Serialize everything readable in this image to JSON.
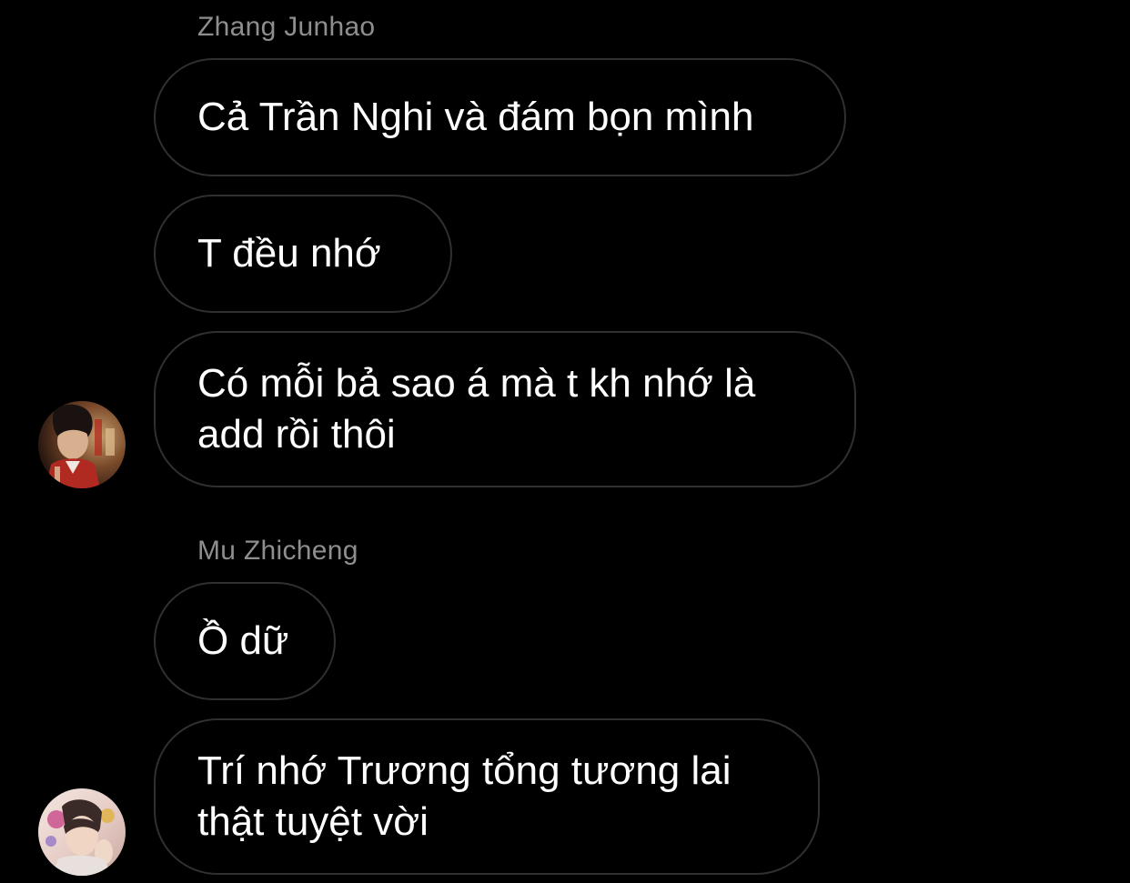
{
  "thread": {
    "groups": [
      {
        "sender": "Zhang Junhao",
        "messages": [
          "Cả Trần Nghi và đám bọn mình",
          "T đều nhớ",
          "Có mỗi bả sao á mà t kh nhớ là add rồi thôi"
        ],
        "avatar_icon": "user-avatar-photo"
      },
      {
        "sender": "Mu Zhicheng",
        "messages": [
          "Ồ dữ",
          "Trí nhớ Trương tổng tương lai thật tuyệt vời"
        ],
        "avatar_icon": "user-avatar-photo"
      }
    ]
  },
  "colors": {
    "background": "#000000",
    "bubble_border": "#303030",
    "sender_name": "#8e8e8e",
    "message_text": "#ffffff"
  }
}
